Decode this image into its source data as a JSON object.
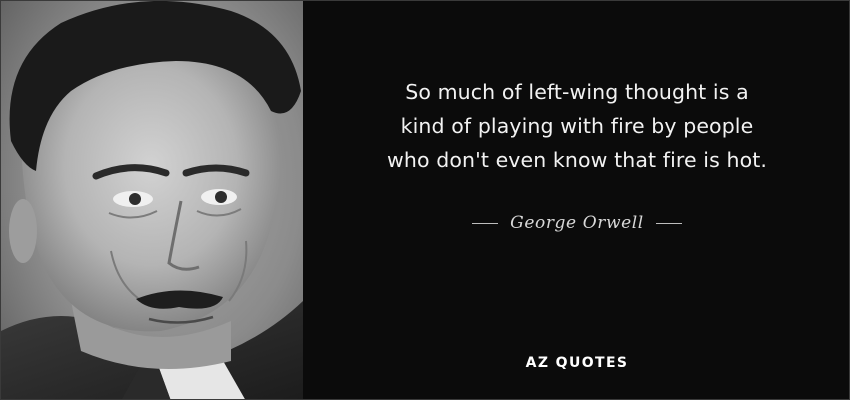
{
  "quote": {
    "lines": [
      "So much of left-wing thought is a",
      "kind of playing with fire by people",
      "who don't even know that fire is hot."
    ]
  },
  "attribution": {
    "dash": "—",
    "author": "George Orwell"
  },
  "brand": {
    "text": "AZ QUOTES"
  },
  "colors": {
    "background": "#0b0b0b",
    "quote_text": "#f2f2f2",
    "author_text": "#d8d8d8",
    "brand_text": "#ffffff"
  },
  "portrait": {
    "subject": "black-and-white portrait photo"
  }
}
